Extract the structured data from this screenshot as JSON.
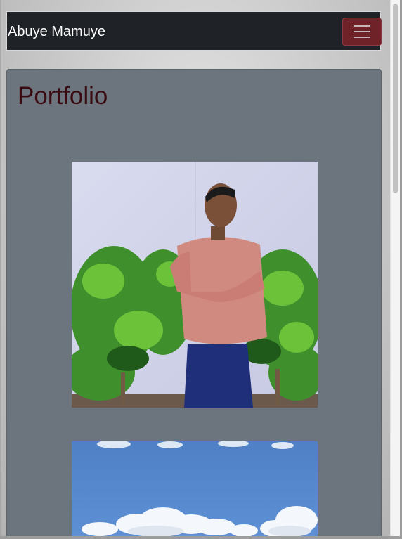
{
  "navbar": {
    "brand": "Abuye Mamuye",
    "toggler_icon": "hamburger-menu-icon"
  },
  "main": {
    "title": "Portfolio",
    "photos": [
      {
        "subject": "portrait-photo"
      },
      {
        "subject": "sky-landscape-photo"
      }
    ]
  },
  "colors": {
    "navbar_bg": "#1f2328",
    "toggler_bg": "#6f2328",
    "card_bg": "#6c757d",
    "title_color": "#3b0b12"
  }
}
